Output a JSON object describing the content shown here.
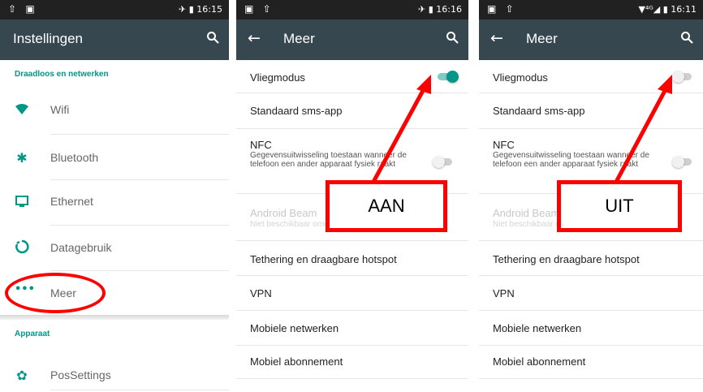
{
  "screens": [
    {
      "status": {
        "left_icons": "⇧ ▣",
        "right": "✈ ▮ 16:15"
      },
      "title": "Instellingen",
      "sections": [
        {
          "header": "Draadloos en netwerken",
          "items": [
            {
              "label": "Wifi",
              "icon": "wifi-icon"
            },
            {
              "label": "Bluetooth",
              "icon": "bluetooth-icon"
            },
            {
              "label": "Ethernet",
              "icon": "ethernet-icon"
            },
            {
              "label": "Datagebruik",
              "icon": "data-usage-icon"
            },
            {
              "label": "Meer",
              "icon": "more-icon"
            }
          ]
        },
        {
          "header": "Apparaat",
          "items": [
            {
              "label": "PosSettings",
              "icon": "gear-icon"
            }
          ]
        }
      ]
    },
    {
      "status": {
        "left_icons": "▣ ⇧",
        "right": "✈ ▮ 16:16"
      },
      "title": "Meer",
      "airplane_mode": {
        "label": "Vliegmodus",
        "state": "on"
      },
      "sms": {
        "label": "Standaard sms-app"
      },
      "nfc": {
        "label": "NFC",
        "desc": "Gegevensuitwisseling toestaan wanneer de telefoon een ander apparaat fysiek raakt",
        "state": "off"
      },
      "beam": {
        "label": "Android Beam",
        "desc": "Niet beschikbaar omdat NFC is uitgeschakeld"
      },
      "tethering": {
        "label": "Tethering en draagbare hotspot"
      },
      "vpn": {
        "label": "VPN"
      },
      "mobile_networks": {
        "label": "Mobiele netwerken"
      },
      "subscription": {
        "label": "Mobiel abonnement"
      },
      "callout": "AAN"
    },
    {
      "status": {
        "left_icons": "▣ ⇧",
        "right": "▼⁴ᴳ◢ ▮ 16:11"
      },
      "title": "Meer",
      "airplane_mode": {
        "label": "Vliegmodus",
        "state": "off"
      },
      "sms": {
        "label": "Standaard sms-app"
      },
      "nfc": {
        "label": "NFC",
        "desc": "Gegevensuitwisseling toestaan wanneer de telefoon een ander apparaat fysiek raakt",
        "state": "off"
      },
      "beam": {
        "label": "Android Beam",
        "desc": "Niet beschikbaar omdat NFC is uitgeschakeld"
      },
      "tethering": {
        "label": "Tethering en draagbare hotspot"
      },
      "vpn": {
        "label": "VPN"
      },
      "mobile_networks": {
        "label": "Mobiele netwerken"
      },
      "subscription": {
        "label": "Mobiel abonnement"
      },
      "callout": "UIT"
    }
  ],
  "colors": {
    "accent": "#009688",
    "appbar": "#37474f",
    "statusbar": "#212121",
    "annotation": "#ff0000"
  }
}
